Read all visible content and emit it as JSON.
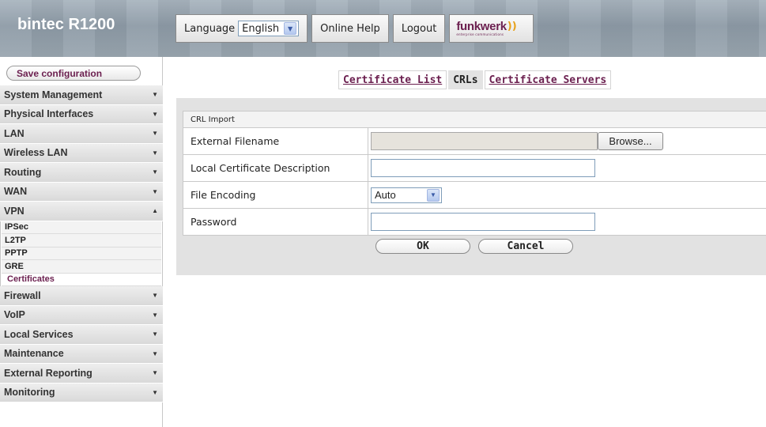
{
  "app": {
    "title": "bintec R1200"
  },
  "topbar": {
    "language_label": "Language",
    "language_value": "English",
    "online_help": "Online Help",
    "logout": "Logout",
    "logo_text": "funkwerk",
    "logo_subtext": "enterprise communications"
  },
  "sidebar": {
    "save_label": "Save configuration",
    "items_before": [
      {
        "label": "System Management"
      },
      {
        "label": "Physical Interfaces"
      },
      {
        "label": "LAN"
      },
      {
        "label": "Wireless LAN"
      },
      {
        "label": "Routing"
      },
      {
        "label": "WAN"
      }
    ],
    "vpn_label": "VPN",
    "vpn_subitems": [
      {
        "label": "IPSec"
      },
      {
        "label": "L2TP"
      },
      {
        "label": "PPTP"
      },
      {
        "label": "GRE"
      },
      {
        "label": "Certificates",
        "active": true
      }
    ],
    "items_after": [
      {
        "label": "Firewall"
      },
      {
        "label": "VoIP"
      },
      {
        "label": "Local Services"
      },
      {
        "label": "Maintenance"
      },
      {
        "label": "External Reporting"
      },
      {
        "label": "Monitoring"
      }
    ]
  },
  "tabs": [
    {
      "label": "Certificate List",
      "active": false
    },
    {
      "label": "CRLs",
      "active": true
    },
    {
      "label": "Certificate Servers",
      "active": false
    }
  ],
  "form": {
    "section_title": "CRL Import",
    "fields": {
      "external_filename": {
        "label": "External Filename",
        "value": "",
        "browse_label": "Browse..."
      },
      "local_description": {
        "label": "Local Certificate Description",
        "value": ""
      },
      "file_encoding": {
        "label": "File Encoding",
        "value": "Auto"
      },
      "password": {
        "label": "Password",
        "value": ""
      }
    },
    "ok_label": "OK",
    "cancel_label": "Cancel"
  },
  "colors": {
    "accent": "#6b1f4f",
    "header_bg": "#97a4ae",
    "panel_bg": "#e2e2e2"
  }
}
